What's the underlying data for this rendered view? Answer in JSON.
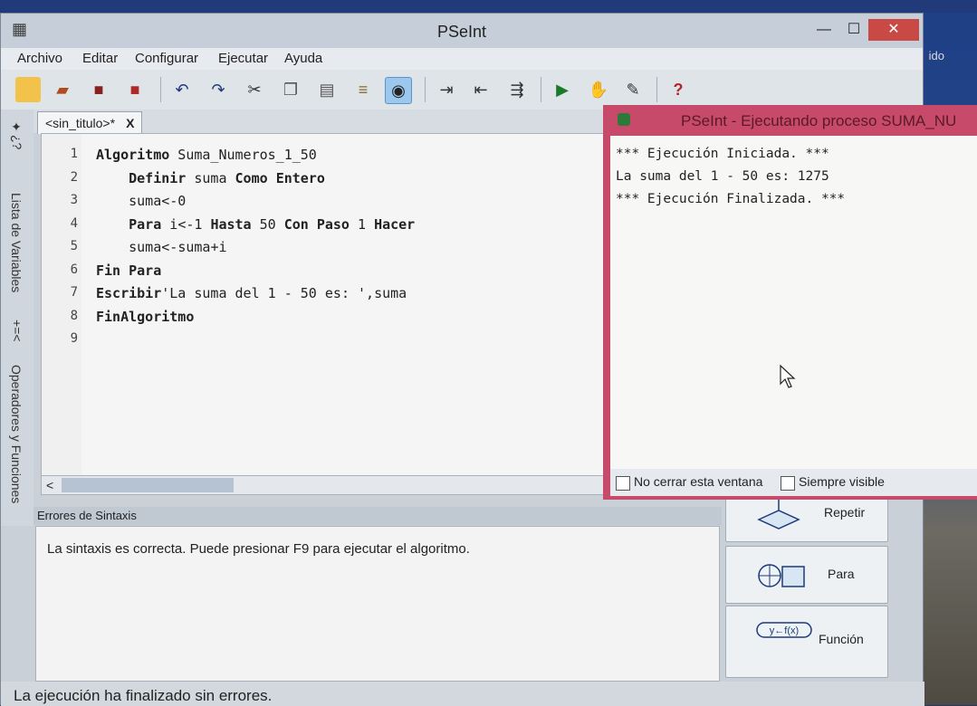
{
  "window": {
    "title": "PSeInt"
  },
  "desktop": {
    "label": "ido"
  },
  "menu": [
    "Archivo",
    "Editar",
    "Configurar",
    "Ejecutar",
    "Ayuda"
  ],
  "toolbar_icons": [
    "new-file",
    "open-folder",
    "save",
    "save-as",
    "undo",
    "redo",
    "cut",
    "copy",
    "paste",
    "edit",
    "view-selected",
    "run-step",
    "indent",
    "unindent",
    "run",
    "run-step-by-step",
    "debug",
    "help"
  ],
  "side_tabs": {
    "variables": "Lista de Variables",
    "operators": "Operadores y Funciones"
  },
  "editor": {
    "tab_label": "<sin_titulo>*",
    "tab_close": "X",
    "lines": [
      {
        "n": "1",
        "code": "Algoritmo Suma_Numeros_1_50"
      },
      {
        "n": "2",
        "code": "    Definir suma Como Entero"
      },
      {
        "n": "3",
        "code": "    suma<-0"
      },
      {
        "n": "4",
        "code": "    Para i<-1 Hasta 50 Con Paso 1 Hacer"
      },
      {
        "n": "5",
        "code": "    suma<-suma+i"
      },
      {
        "n": "6",
        "code": "Fin Para"
      },
      {
        "n": "7",
        "code": "Escribir'La suma del 1 - 50 es: ',suma"
      },
      {
        "n": "8",
        "code": "FinAlgoritmo"
      },
      {
        "n": "9",
        "code": ""
      }
    ]
  },
  "errors": {
    "title": "Errores de Sintaxis",
    "message": "La sintaxis es correcta. Puede presionar F9 para ejecutar el algoritmo."
  },
  "commands": [
    {
      "label": "Repetir",
      "icon": "repeat-icon"
    },
    {
      "label": "Para",
      "icon": "for-loop-icon"
    },
    {
      "label": "Función",
      "icon": "function-icon",
      "icon_text": "y←f(x)"
    }
  ],
  "status": "La ejecución ha finalizado sin errores.",
  "execution": {
    "title": "PSeInt - Ejecutando proceso SUMA_NU",
    "output": [
      "*** Ejecución Iniciada. ***",
      "La suma del 1 - 50 es: 1275",
      "*** Ejecución Finalizada. ***"
    ],
    "no_close_label": "No cerrar esta ventana",
    "always_visible_label": "Siempre visible"
  }
}
